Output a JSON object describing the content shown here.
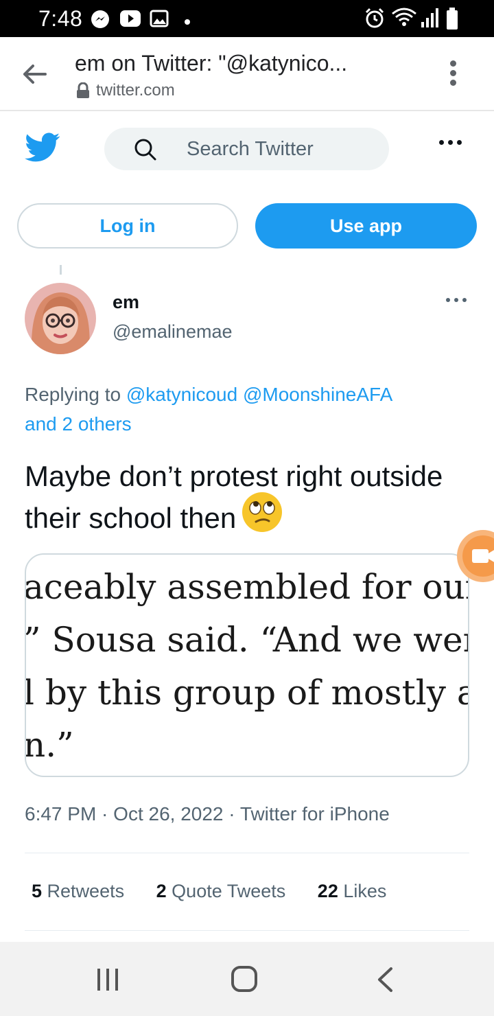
{
  "status_bar": {
    "time": "7:48",
    "icons": [
      "messenger-icon",
      "youtube-icon",
      "gallery-icon",
      "notification-dot-icon",
      "alarm-icon",
      "wifi-icon",
      "signal-icon",
      "battery-icon"
    ]
  },
  "browser": {
    "title": "em on Twitter: \"@katynico...",
    "url": "twitter.com"
  },
  "twitter_header": {
    "search_placeholder": "Search Twitter",
    "login_label": "Log in",
    "use_app_label": "Use app"
  },
  "tweet": {
    "author_name": "em",
    "author_handle": "@emalinemae",
    "replying_prefix": "Replying to",
    "replying_mention_1": "@katynicoud",
    "replying_mention_2": "@MoonshineAFA",
    "replying_others": "and 2 others",
    "text": "Maybe don’t protest right outside their school then",
    "media_lines": [
      "aceably assembled for our f",
      "” Sousa said. “And we were",
      "l by this group of mostly an",
      "n.”"
    ],
    "time": "6:47 PM",
    "date": "Oct 26, 2022",
    "source": "Twitter for iPhone",
    "meta_separator": " · ",
    "retweets_count": "5",
    "retweets_label": "Retweets",
    "quotes_count": "2",
    "quotes_label": "Quote Tweets",
    "likes_count": "22",
    "likes_label": "Likes"
  },
  "colors": {
    "twitter_blue": "#1d9bf0",
    "text_primary": "#0f1419",
    "text_secondary": "#536471"
  }
}
